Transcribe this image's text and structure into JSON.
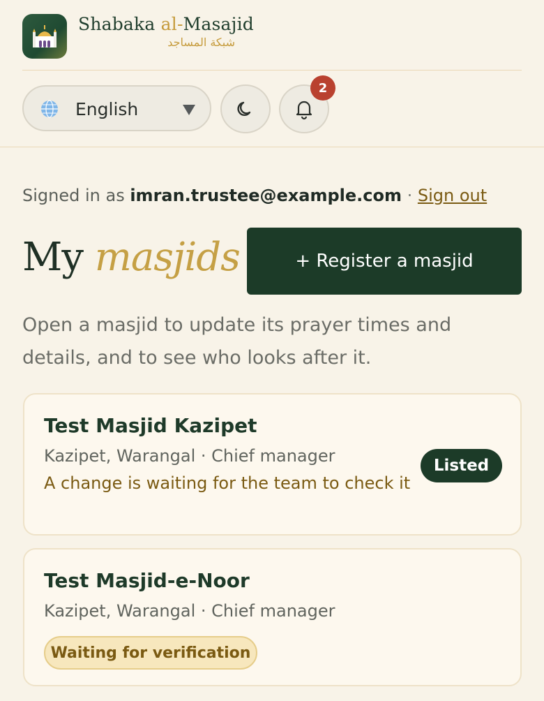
{
  "brand": {
    "name_prefix": "Shabaka ",
    "name_accent": "al-",
    "name_suffix": "Masajid",
    "arabic": "شبكة المساجد",
    "logo_icon": "mosque-icon"
  },
  "header": {
    "language": "English",
    "globe_icon": "globe-icon",
    "theme_icon": "moon-icon",
    "bell_icon": "bell-icon",
    "notification_count": "2"
  },
  "account": {
    "prefix": "Signed in as ",
    "email": "imran.trustee@example.com",
    "separator": " · ",
    "sign_out": "Sign out"
  },
  "main": {
    "title_plain": "My ",
    "title_accent": "masjids",
    "register_label": "+ Register a masjid",
    "intro": "Open a masjid to update its prayer times and details, and to see who looks after it."
  },
  "masjids": [
    {
      "name": "Test Masjid Kazipet",
      "meta": "Kazipet, Warangal · Chief manager",
      "note": "A change is waiting for the team to check it",
      "status": "Listed"
    },
    {
      "name": "Test Masjid-e-Noor",
      "meta": "Kazipet, Warangal · Chief manager",
      "status": "Waiting for verification"
    }
  ],
  "colors": {
    "background": "#f8f3e8",
    "primary": "#1c3b28",
    "gold": "#c59a3a",
    "badge_red": "#b9412f"
  }
}
